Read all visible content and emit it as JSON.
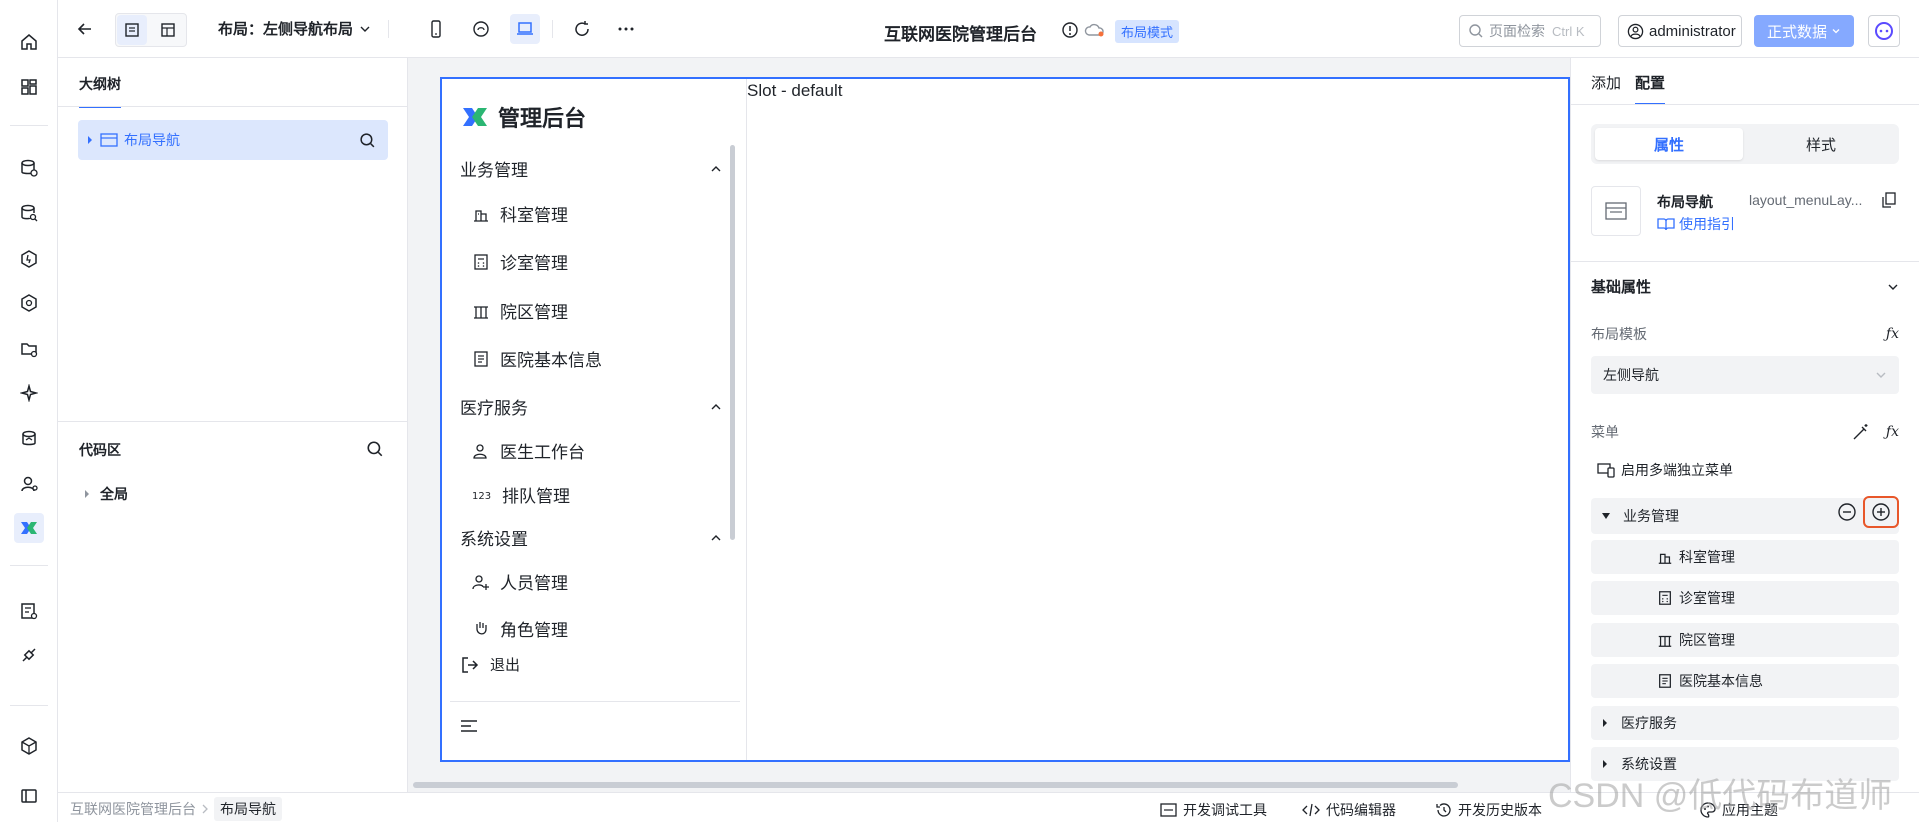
{
  "header": {
    "layout_label": "布局：左侧导航布局",
    "app_title": "互联网医院管理后台",
    "mode_tag": "布局模式",
    "search_placeholder": "页面检索",
    "search_shortcut": "Ctrl K",
    "user": "administrator",
    "data_button": "正式数据"
  },
  "outline": {
    "tab": "大纲树",
    "node": "布局导航"
  },
  "code": {
    "title": "代码区",
    "node": "全局"
  },
  "canvas": {
    "brand": "管理后台",
    "slot": "Slot - default",
    "groups": [
      {
        "label": "业务管理",
        "items": [
          "科室管理",
          "诊室管理",
          "院区管理",
          "医院基本信息"
        ]
      },
      {
        "label": "医疗服务",
        "items": [
          "医生工作台",
          "排队管理"
        ]
      },
      {
        "label": "系统设置",
        "items": [
          "人员管理",
          "角色管理"
        ]
      }
    ],
    "logout": "退出"
  },
  "config": {
    "tabs": [
      "添加",
      "配置"
    ],
    "segments": [
      "属性",
      "样式"
    ],
    "component_name": "布局导航",
    "component_id": "layout_menuLay...",
    "guide": "使用指引",
    "basic_title": "基础属性",
    "template_label": "布局模板",
    "template_value": "左侧导航",
    "menu_label": "菜单",
    "multi_menu": "启用多端独立菜单",
    "menu_tree": {
      "expanded_group": "业务管理",
      "children": [
        "科室管理",
        "诊室管理",
        "院区管理",
        "医院基本信息"
      ],
      "collapsed_groups": [
        "医疗服务",
        "系统设置"
      ]
    }
  },
  "statusbar": {
    "crumbs": [
      "互联网医院管理后台",
      "布局导航"
    ],
    "debug_tools": "开发调试工具",
    "code_editor": "代码编辑器",
    "history": "开发历史版本",
    "theme": "应用主题"
  },
  "watermark": "CSDN @低代码布道师",
  "colors": {
    "accent": "#3370ff",
    "selection_bg": "#dce7fd",
    "highlight_border": "#e8572a",
    "primary_button": "#85a9ff"
  }
}
